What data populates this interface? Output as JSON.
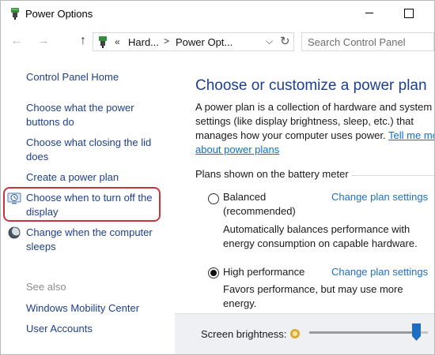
{
  "window": {
    "title": "Power Options",
    "icon": "power-options-icon"
  },
  "navbar": {
    "back_icon": "back-arrow-icon",
    "forward_icon": "forward-arrow-icon",
    "up_icon": "up-arrow-icon",
    "address": {
      "chevrons": "«",
      "crumb1": "Hard...",
      "separator": ">",
      "crumb2": "Power Opt..."
    },
    "search_placeholder": "Search Control Panel"
  },
  "sidebar": {
    "home": "Control Panel Home",
    "items": [
      {
        "label_line1": "Choose what the power",
        "label_line2": "buttons do"
      },
      {
        "label_line1": "Choose what closing the lid",
        "label_line2": "does"
      },
      {
        "label_line1": "Create a power plan"
      },
      {
        "label_line1": "Choose when to turn off the",
        "label_line2": "display",
        "icon": "display-clock-icon",
        "highlighted": true
      },
      {
        "label_line1": "Change when the computer",
        "label_line2": "sleeps",
        "icon": "moon-icon"
      }
    ],
    "see_also_title": "See also",
    "see_also": [
      "Windows Mobility Center",
      "User Accounts"
    ]
  },
  "main": {
    "heading": "Choose or customize a power plan",
    "desc_text": "A power plan is a collection of hardware and system settings (like display brightness, sleep, etc.) that manages how your computer uses power.",
    "desc_link": "Tell me more about power plans",
    "plans_title": "Plans shown on the battery meter",
    "plans": [
      {
        "name": "Balanced",
        "subtitle": "(recommended)",
        "selected": false,
        "change_label": "Change plan settings",
        "desc_line1": "Automatically balances performance with",
        "desc_line2": "energy consumption on capable hardware."
      },
      {
        "name": "High performance",
        "selected": true,
        "change_label": "Change plan settings",
        "desc_line1": "Favors performance, but may use more",
        "desc_line2": "energy."
      }
    ]
  },
  "brightness": {
    "label": "Screen brightness:",
    "icon": "brightness-sun-icon",
    "level": 0.9
  },
  "colors": {
    "link": "#1e3f8a",
    "accent_link": "#0a6fd6",
    "highlight": "#c7363d",
    "slider_thumb": "#1e6fc4"
  }
}
